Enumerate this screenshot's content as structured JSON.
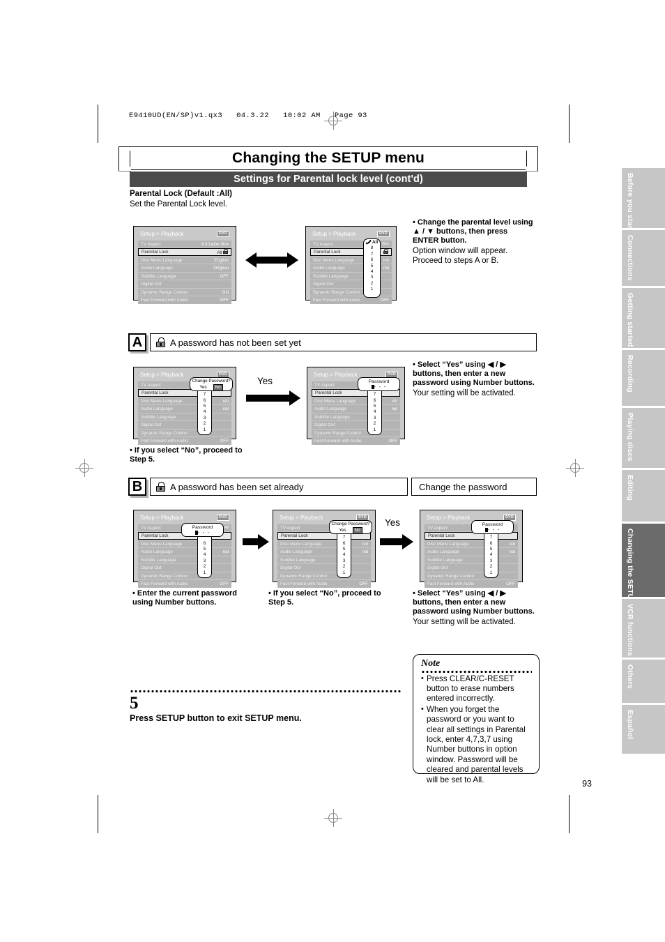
{
  "slug": "E9410UD(EN/SP)v1.qx3   04.3.22   10:02 AM   Page 93",
  "banner_title": "Changing the SETUP menu",
  "sub_bar": "Settings for Parental lock level (cont'd)",
  "section_heading": "Parental Lock (Default :All)",
  "section_sub": "Set the Parental Lock level.",
  "page_number": "93",
  "menu": {
    "title": "Setup > Playback",
    "disc_badge": "DVD",
    "rows": [
      {
        "label": "TV Aspect",
        "value": "4:3 Letter Box"
      },
      {
        "label": "Parental Lock",
        "value": "All"
      },
      {
        "label": "Disc Menu Language",
        "value": "English"
      },
      {
        "label": "Audio Language",
        "value": "Original"
      },
      {
        "label": "Subtitle Language",
        "value": "OFF"
      },
      {
        "label": "Digital Out",
        "value": ""
      },
      {
        "label": "Dynamic Range Control",
        "value": "ON"
      },
      {
        "label": "Fast Forward with Audio",
        "value": "OFF"
      }
    ],
    "level_options": [
      "All",
      "8",
      "7",
      "6",
      "5",
      "4",
      "3",
      "2",
      "1"
    ],
    "level_selected": "All",
    "level_partial": [
      "7",
      "6",
      "5",
      "4",
      "3",
      "2",
      "1"
    ],
    "password_title": "Password",
    "password_dots": "- - -",
    "change_password_q": "Change Password?",
    "yes_label": "Yes",
    "no_label": "No"
  },
  "step_change_level": {
    "bold": "• Change the parental level using ▲ / ▼ buttons, then press ENTER button.",
    "line1": "Option window will appear.",
    "line2": "Proceed to steps A or B."
  },
  "section_a": {
    "mark": "A",
    "title": "A password has not been set yet",
    "arrow_label": "Yes",
    "note_left": "• If you select “No”, proceed to Step 5.",
    "bullet_bold": "• Select “Yes” using ◀ / ▶ buttons, then enter a new password using Number buttons.",
    "bullet_plain": "Your setting will be activated."
  },
  "section_b": {
    "mark": "B",
    "title": "A password has been set already",
    "title_right": "Change the password",
    "arrow_label": "Yes",
    "note1": "• Enter the current password using Number buttons.",
    "note2": "• If you select “No”, proceed to Step 5.",
    "bullet_bold": "• Select “Yes” using ◀ / ▶ buttons, then enter a new password using Number buttons.",
    "bullet_plain": "Your setting will be activated."
  },
  "step5": {
    "number": "5",
    "text": "Press SETUP button to exit SETUP menu."
  },
  "note": {
    "title": "Note",
    "items": [
      "Press CLEAR/C-RESET button to erase numbers entered incorrectly.",
      "When you forget the password or you want to clear all settings in Parental lock, enter 4,7,3,7 using Number buttons in option window. Password will be cleared and parental levels will be set to All."
    ]
  },
  "side_tabs": [
    {
      "label": "Before you start",
      "active": false
    },
    {
      "label": "Connections",
      "active": false
    },
    {
      "label": "Getting started",
      "active": false
    },
    {
      "label": "Recording",
      "active": false
    },
    {
      "label": "Playing discs",
      "active": false
    },
    {
      "label": "Editing",
      "active": false
    },
    {
      "label": "Changing the SETUP menu",
      "active": true
    },
    {
      "label": "VCR functions",
      "active": false
    },
    {
      "label": "Others",
      "active": false
    },
    {
      "label": "Español",
      "active": false
    }
  ],
  "colors": {
    "bar": "#4b4b4b",
    "tab_inactive": "#c6c6c6",
    "tab_active": "#6b6b6b",
    "menu_bg": "#c9c9c9"
  }
}
